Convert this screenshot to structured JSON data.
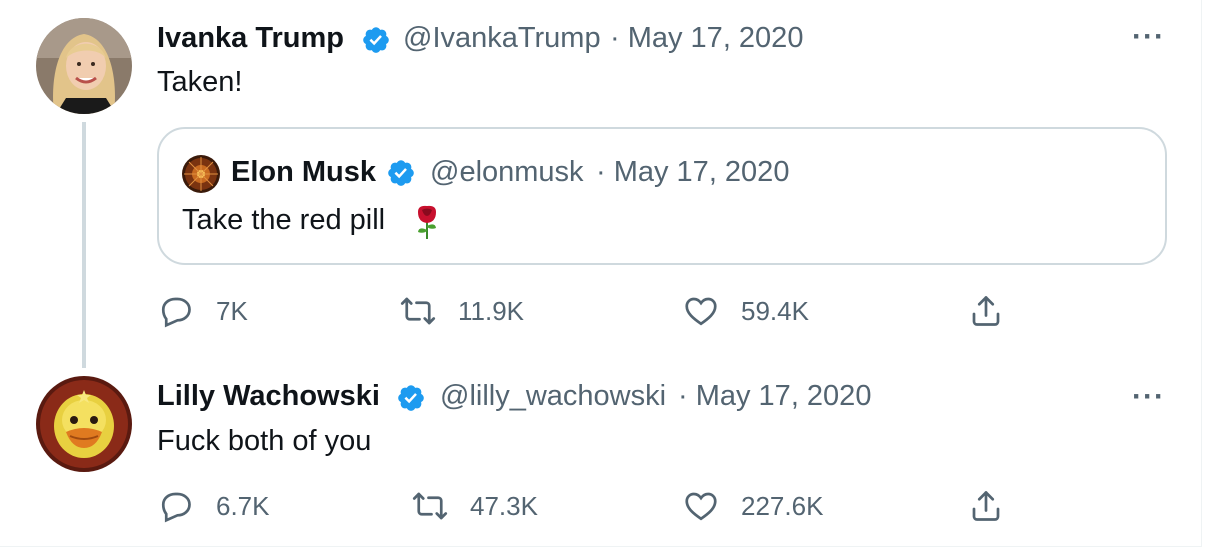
{
  "colors": {
    "text": "#0f1419",
    "secondary": "#536471",
    "verified": "#1d9bf0",
    "border": "#cfd9de",
    "rose": "#c8102e"
  },
  "tweet1": {
    "name": "Ivanka Trump",
    "handle": "@IvankaTrump",
    "date": "· May 17, 2020",
    "text": "Taken!",
    "more_icon": "more-horizontal-icon",
    "quote": {
      "name": "Elon Musk",
      "handle": "@elonmusk",
      "date": "· May 17, 2020",
      "text": "Take the red pill",
      "emoji_icon": "rose-emoji-icon"
    },
    "actions": {
      "reply": "7K",
      "retweet": "11.9K",
      "like": "59.4K"
    }
  },
  "tweet2": {
    "name": "Lilly Wachowski",
    "handle": "@lilly_wachowski",
    "date": "· May 17, 2020",
    "text": "Fuck both of you",
    "more_icon": "more-horizontal-icon",
    "actions": {
      "reply": "6.7K",
      "retweet": "47.3K",
      "like": "227.6K"
    }
  }
}
